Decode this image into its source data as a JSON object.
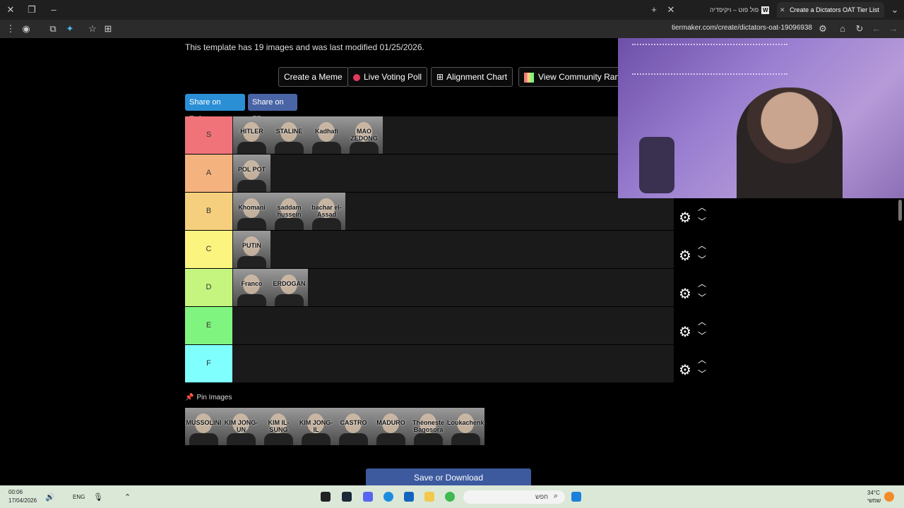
{
  "browser": {
    "tabs": [
      {
        "label": "פול פוט – ויקיפדיה",
        "favicon": "W"
      },
      {
        "label": "Create a Dictators OAT Tier List",
        "favicon": "T"
      }
    ],
    "url": "tiermaker.com/create/dictators-oat-19096938"
  },
  "page": {
    "template_info": "This template has 19 images and was last modified 01/25/2026.",
    "buttons": {
      "create_meme": "Create a Meme",
      "live_poll": "Live Voting Poll",
      "alignment": "Alignment Chart",
      "community": "View Community Rank"
    },
    "share": {
      "twitter": "Share on Twitter",
      "fb": "Share on FB"
    },
    "tiers": [
      {
        "label": "S",
        "color": "#f0737a",
        "items": [
          "HITLER",
          "STALINE",
          "Kadhafi",
          "MAO ZEDONG"
        ]
      },
      {
        "label": "A",
        "color": "#f4b27f",
        "items": [
          "POL POT"
        ]
      },
      {
        "label": "B",
        "color": "#f6cf7e",
        "items": [
          "Khomani",
          "saddam hussein",
          "bachar el-Assad"
        ]
      },
      {
        "label": "C",
        "color": "#fbf57f",
        "items": [
          "PUTIN"
        ]
      },
      {
        "label": "D",
        "color": "#c6f57f",
        "items": [
          "Franco",
          "ERDOGAN"
        ]
      },
      {
        "label": "E",
        "color": "#7ff57f",
        "items": []
      },
      {
        "label": "F",
        "color": "#7ffffe",
        "items": []
      }
    ],
    "pin_label": "Pin Images",
    "pool": [
      "MUSSOLINI",
      "KIM JONG-UN",
      "KIM IL-SUNG",
      "KIM JONG-IL",
      "CASTRO",
      "MADURO",
      "Théoneste Bagosora",
      "Loukachenko"
    ],
    "save_label": "Save or Download"
  },
  "taskbar": {
    "time": "00:06",
    "date": "17/04/2026",
    "lang": "ENG",
    "search_placeholder": "חפש",
    "weather_temp": "34°C",
    "weather_desc": "שמשי"
  }
}
